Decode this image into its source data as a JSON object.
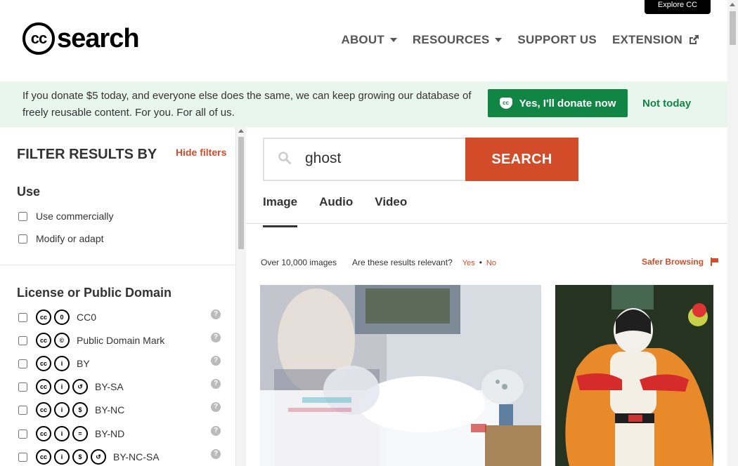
{
  "top": {
    "explore_cc": "Explore CC"
  },
  "header": {
    "logo_cc": "cc",
    "logo_text": "search",
    "nav": [
      {
        "label": "ABOUT",
        "has_caret": true
      },
      {
        "label": "RESOURCES",
        "has_caret": true
      },
      {
        "label": "SUPPORT US",
        "has_caret": false
      },
      {
        "label": "EXTENSION",
        "has_caret": false,
        "icon": "external-link-icon"
      }
    ]
  },
  "banner": {
    "text": "If you donate $5 today, and everyone else does the same, we can keep growing our database of freely reusable content. For you. For all of us.",
    "donate_button": "Yes, I'll donate now",
    "not_today": "Not today"
  },
  "sidebar": {
    "title": "FILTER RESULTS BY",
    "hide_filters": "Hide filters",
    "use": {
      "title": "Use",
      "options": [
        "Use commercially",
        "Modify or adapt"
      ]
    },
    "license": {
      "title": "License or Public Domain",
      "options": [
        {
          "label": "CC0",
          "icons": [
            "cc",
            "0"
          ]
        },
        {
          "label": "Public Domain Mark",
          "icons": [
            "cc",
            "pd"
          ]
        },
        {
          "label": "BY",
          "icons": [
            "cc",
            "by"
          ]
        },
        {
          "label": "BY-SA",
          "icons": [
            "cc",
            "by",
            "sa"
          ]
        },
        {
          "label": "BY-NC",
          "icons": [
            "cc",
            "by",
            "nc"
          ]
        },
        {
          "label": "BY-ND",
          "icons": [
            "cc",
            "by",
            "nd"
          ]
        },
        {
          "label": "BY-NC-SA",
          "icons": [
            "cc",
            "by",
            "nc",
            "sa"
          ]
        }
      ]
    }
  },
  "search": {
    "value": "ghost",
    "button": "SEARCH"
  },
  "tabs": [
    {
      "label": "Image",
      "active": true
    },
    {
      "label": "Audio",
      "active": false
    },
    {
      "label": "Video",
      "active": false
    }
  ],
  "results": {
    "count": "Over 10,000 images",
    "relevant_question": "Are these results relevant?",
    "yes": "Yes",
    "separator": "•",
    "no": "No",
    "safer_browsing": "Safer Browsing"
  },
  "colors": {
    "accent": "#d24c2a",
    "donate_green": "#118543",
    "banner_bg": "#e8f6ee"
  }
}
